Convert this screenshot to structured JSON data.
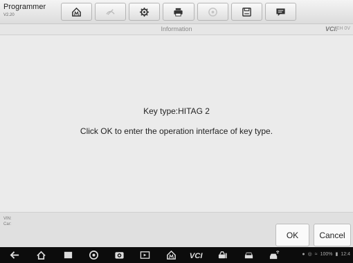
{
  "header": {
    "app_title": "Programmer",
    "version": "V2.20"
  },
  "toolbar": {
    "buttons": [
      "home-icon",
      "vehicle-swap-icon",
      "settings-gear-icon",
      "printer-icon",
      "help-icon",
      "save-icon",
      "message-icon"
    ]
  },
  "info_bar": {
    "title": "Information",
    "vci_label": "VCI:",
    "vci_status": "EH 0V"
  },
  "main": {
    "key_type": "Key type:HITAG 2",
    "message": "Click OK to enter the operation interface of key type."
  },
  "footer": {
    "vin_label": "VIN:",
    "car_label": "Car:",
    "ok_label": "OK",
    "cancel_label": "Cancel"
  },
  "navbar": {
    "status": "100%",
    "clock": "12:4"
  }
}
